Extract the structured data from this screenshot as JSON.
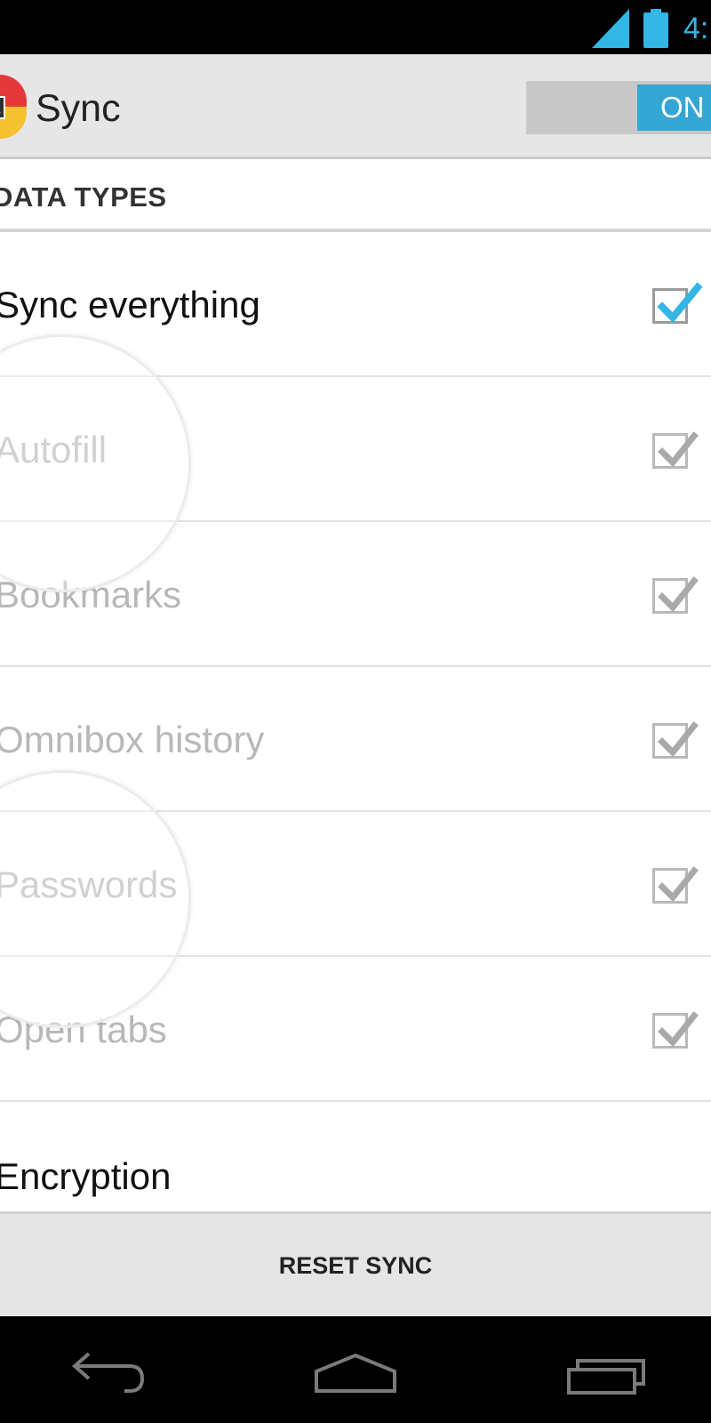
{
  "status_bar": {
    "time": "4:",
    "signal_icon": "signal-icon",
    "battery_icon": "battery-icon",
    "accent_color": "#33b5e5"
  },
  "action_bar": {
    "app_icon": "app-icon",
    "app_icon_text": "TA",
    "title": "Sync",
    "master_toggle": {
      "label": "ON",
      "state": "on"
    }
  },
  "section": {
    "title": "DATA TYPES"
  },
  "rows": [
    {
      "label": "Sync everything",
      "checked": true,
      "enabled": true
    },
    {
      "label": "Autofill",
      "checked": true,
      "enabled": false
    },
    {
      "label": "Bookmarks",
      "checked": true,
      "enabled": false
    },
    {
      "label": "Omnibox history",
      "checked": true,
      "enabled": false
    },
    {
      "label": "Passwords",
      "checked": true,
      "enabled": false
    },
    {
      "label": "Open tabs",
      "checked": true,
      "enabled": false
    }
  ],
  "encryption": {
    "label": "Encryption"
  },
  "footer": {
    "reset_label": "RESET SYNC"
  },
  "nav_bar": {
    "back_icon": "back-icon",
    "home_icon": "home-icon",
    "recent_icon": "recent-apps-icon"
  },
  "colors": {
    "checkbox_active_check": "#33b5e5",
    "checkbox_disabled_check": "#a9a9a9",
    "toggle_on": "#33a6d4"
  }
}
